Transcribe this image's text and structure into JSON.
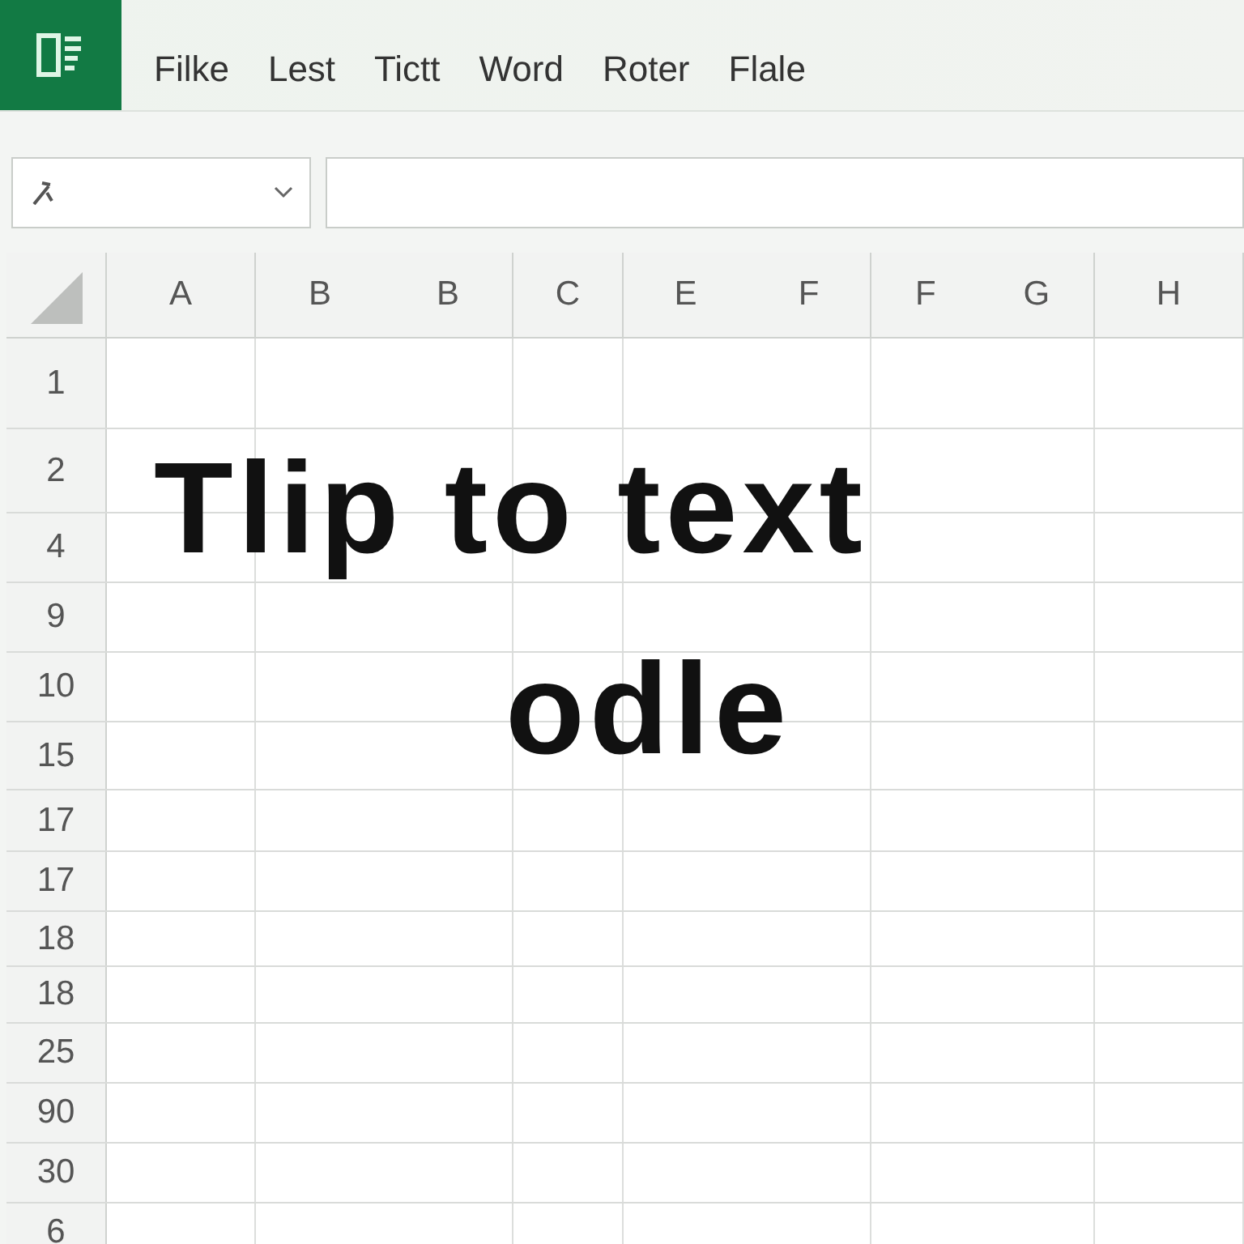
{
  "menu": [
    "Filke",
    "Lest",
    "Tictt",
    "Word",
    "Roter",
    "Flale"
  ],
  "columns": [
    {
      "labels": [
        "A"
      ]
    },
    {
      "labels": [
        "B",
        "B"
      ]
    },
    {
      "labels": [
        "C"
      ]
    },
    {
      "labels": [
        "E",
        "F"
      ]
    },
    {
      "labels": [
        "F",
        "G"
      ]
    },
    {
      "labels": [
        "H"
      ]
    }
  ],
  "rows": [
    "1",
    "2",
    "4",
    "9",
    "10",
    "15",
    "17",
    "17",
    "18",
    "18",
    "25",
    "90",
    "30",
    "6"
  ],
  "overlay_text": [
    "Tlip to text",
    "odle"
  ]
}
